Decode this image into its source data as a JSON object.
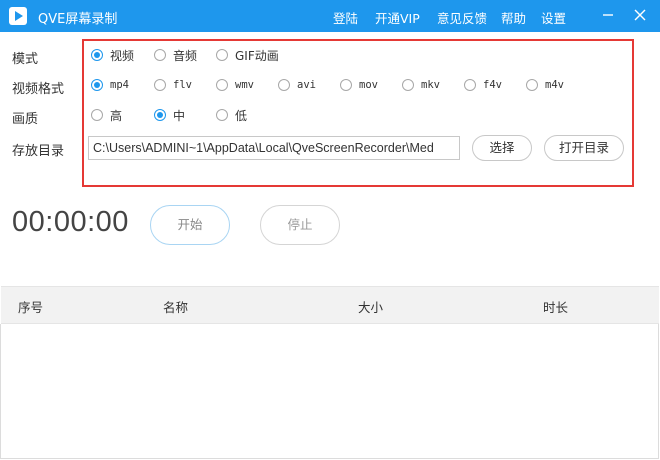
{
  "app": {
    "title": "QVE屏幕录制"
  },
  "menu": {
    "login": "登陆",
    "vip": "开通VIP",
    "feedback": "意见反馈",
    "help": "帮助",
    "settings": "设置"
  },
  "labels": {
    "mode": "模式",
    "format": "视频格式",
    "quality": "画质",
    "directory": "存放目录"
  },
  "mode_options": [
    {
      "label": "视频",
      "checked": true
    },
    {
      "label": "音频",
      "checked": false
    },
    {
      "label": "GIF动画",
      "checked": false
    }
  ],
  "format_options": [
    {
      "label": "mp4",
      "checked": true
    },
    {
      "label": "flv",
      "checked": false
    },
    {
      "label": "wmv",
      "checked": false
    },
    {
      "label": "avi",
      "checked": false
    },
    {
      "label": "mov",
      "checked": false
    },
    {
      "label": "mkv",
      "checked": false
    },
    {
      "label": "f4v",
      "checked": false
    },
    {
      "label": "m4v",
      "checked": false
    }
  ],
  "quality_options": [
    {
      "label": "高",
      "checked": false
    },
    {
      "label": "中",
      "checked": true
    },
    {
      "label": "低",
      "checked": false
    }
  ],
  "directory": {
    "path": "C:\\Users\\ADMINI~1\\AppData\\Local\\QveScreenRecorder\\Med",
    "choose_label": "选择",
    "open_label": "打开目录"
  },
  "recorder": {
    "timer": "00:00:00",
    "start_label": "开始",
    "stop_label": "停止"
  },
  "table": {
    "columns": [
      "序号",
      "名称",
      "大小",
      "时长"
    ],
    "rows": []
  },
  "colors": {
    "titlebar": "#1e97ed",
    "highlight": "#e53935",
    "radio_checked": "#1e97ed"
  },
  "icons": {
    "app": "play-icon",
    "minimize": "minimize-icon",
    "close": "close-icon"
  }
}
